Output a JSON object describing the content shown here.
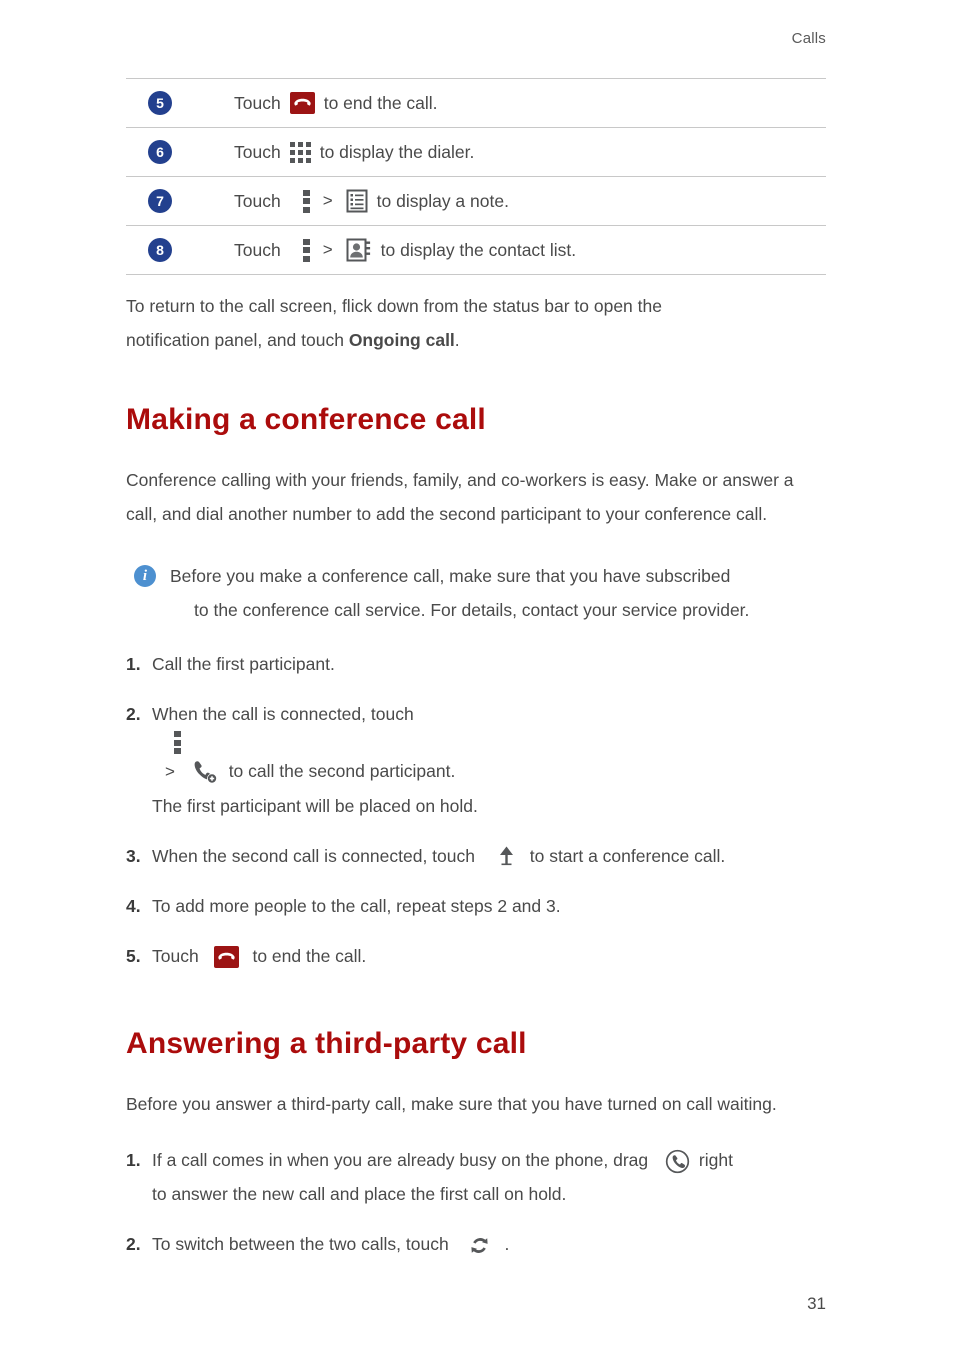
{
  "header": {
    "section": "Calls"
  },
  "footer": {
    "page_number": "31"
  },
  "colors": {
    "heading_red": "#ab0c0c",
    "badge_blue": "#23408e",
    "info_blue": "#4d90d0",
    "endcall_red": "#9c1414",
    "icon_gray": "#555759",
    "rule_gray": "#c8c8c8",
    "body_text": "#4a4a4a"
  },
  "steps_table": {
    "rows": [
      {
        "number": "5",
        "touch_label": "Touch",
        "icon": "end-call-icon",
        "text_after": "to end the call."
      },
      {
        "number": "6",
        "touch_label": "Touch",
        "icon": "dialer-grid-icon",
        "text_after": "to display the dialer."
      },
      {
        "number": "7",
        "touch_label": "Touch",
        "icon": "overflow-menu-icon",
        "separator": ">",
        "icon2": "note-icon",
        "text_after": "to display a note."
      },
      {
        "number": "8",
        "touch_label": "Touch",
        "icon": "overflow-menu-icon",
        "separator": ">",
        "icon2": "contact-list-icon",
        "text_after": "to display the contact list."
      }
    ]
  },
  "intro_paragraph": {
    "line1": "To return to the call screen, flick down from the status bar to open the",
    "line2_before": "notification panel, and touch ",
    "line2_bold": "Ongoing call",
    "line2_after": "."
  },
  "section_conference": {
    "heading": "Making a conference call",
    "paragraph": "Conference calling with your friends, family, and co-workers is easy. Make or answer a call, and dial another number to add the second participant to your conference call.",
    "note": {
      "icon": "info-icon",
      "line1": "Before you make a conference call, make sure that you have subscribed",
      "line2": "to the conference call service. For details, contact your service provider."
    },
    "steps": [
      {
        "marker": "1.",
        "text": "Call the first participant."
      },
      {
        "marker": "2.",
        "text_before": "When the call is connected, touch",
        "icon": "overflow-menu-icon",
        "separator": ">",
        "icon2": "add-call-icon",
        "text_after": "to call the second participant.",
        "line2": "The first participant will be placed on hold."
      },
      {
        "marker": "3.",
        "text_before": "When the second call is connected, touch",
        "icon": "merge-calls-icon",
        "text_after": "to start a conference call."
      },
      {
        "marker": "4.",
        "text": "To add more people to the call, repeat steps 2 and 3."
      },
      {
        "marker": "5.",
        "text_before": "Touch",
        "icon": "end-call-icon",
        "text_after": "to end the call."
      }
    ]
  },
  "section_third_party": {
    "heading": "Answering a third-party call",
    "paragraph": "Before you answer a third-party call, make sure that you have turned on call waiting.",
    "steps": [
      {
        "marker": "1.",
        "text_before": "If a call comes in when you are already busy on the phone, drag",
        "icon": "answer-call-icon",
        "text_after": "right",
        "line2": "to answer the new call and place the first call on hold."
      },
      {
        "marker": "2.",
        "text_before": "To switch between the two calls, touch",
        "icon": "swap-calls-icon",
        "text_after": "."
      }
    ]
  }
}
